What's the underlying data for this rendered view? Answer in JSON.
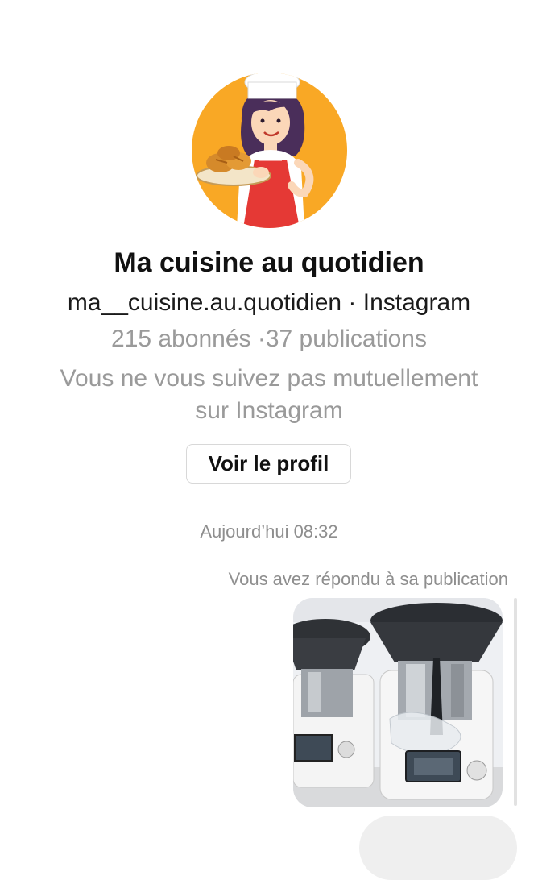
{
  "profile": {
    "avatar_icon": "chef-illustration-avatar",
    "avatar_bg": "#f9a825",
    "name": "Ma cuisine au quotidien",
    "handle_line": "ma__cuisine.au.quotidien · Instagram",
    "stats_line": "215 abonnés ·37 publications",
    "mutual_line1": "Vous ne vous suivez pas mutuellement",
    "mutual_line2": "sur Instagram",
    "view_profile_label": "Voir le profil"
  },
  "thread": {
    "timestamp": "Aujourd’hui 08:32",
    "reply_note": "Vous avez répondu à sa publication",
    "shared_post_icon": "kitchen-robot-photo"
  }
}
